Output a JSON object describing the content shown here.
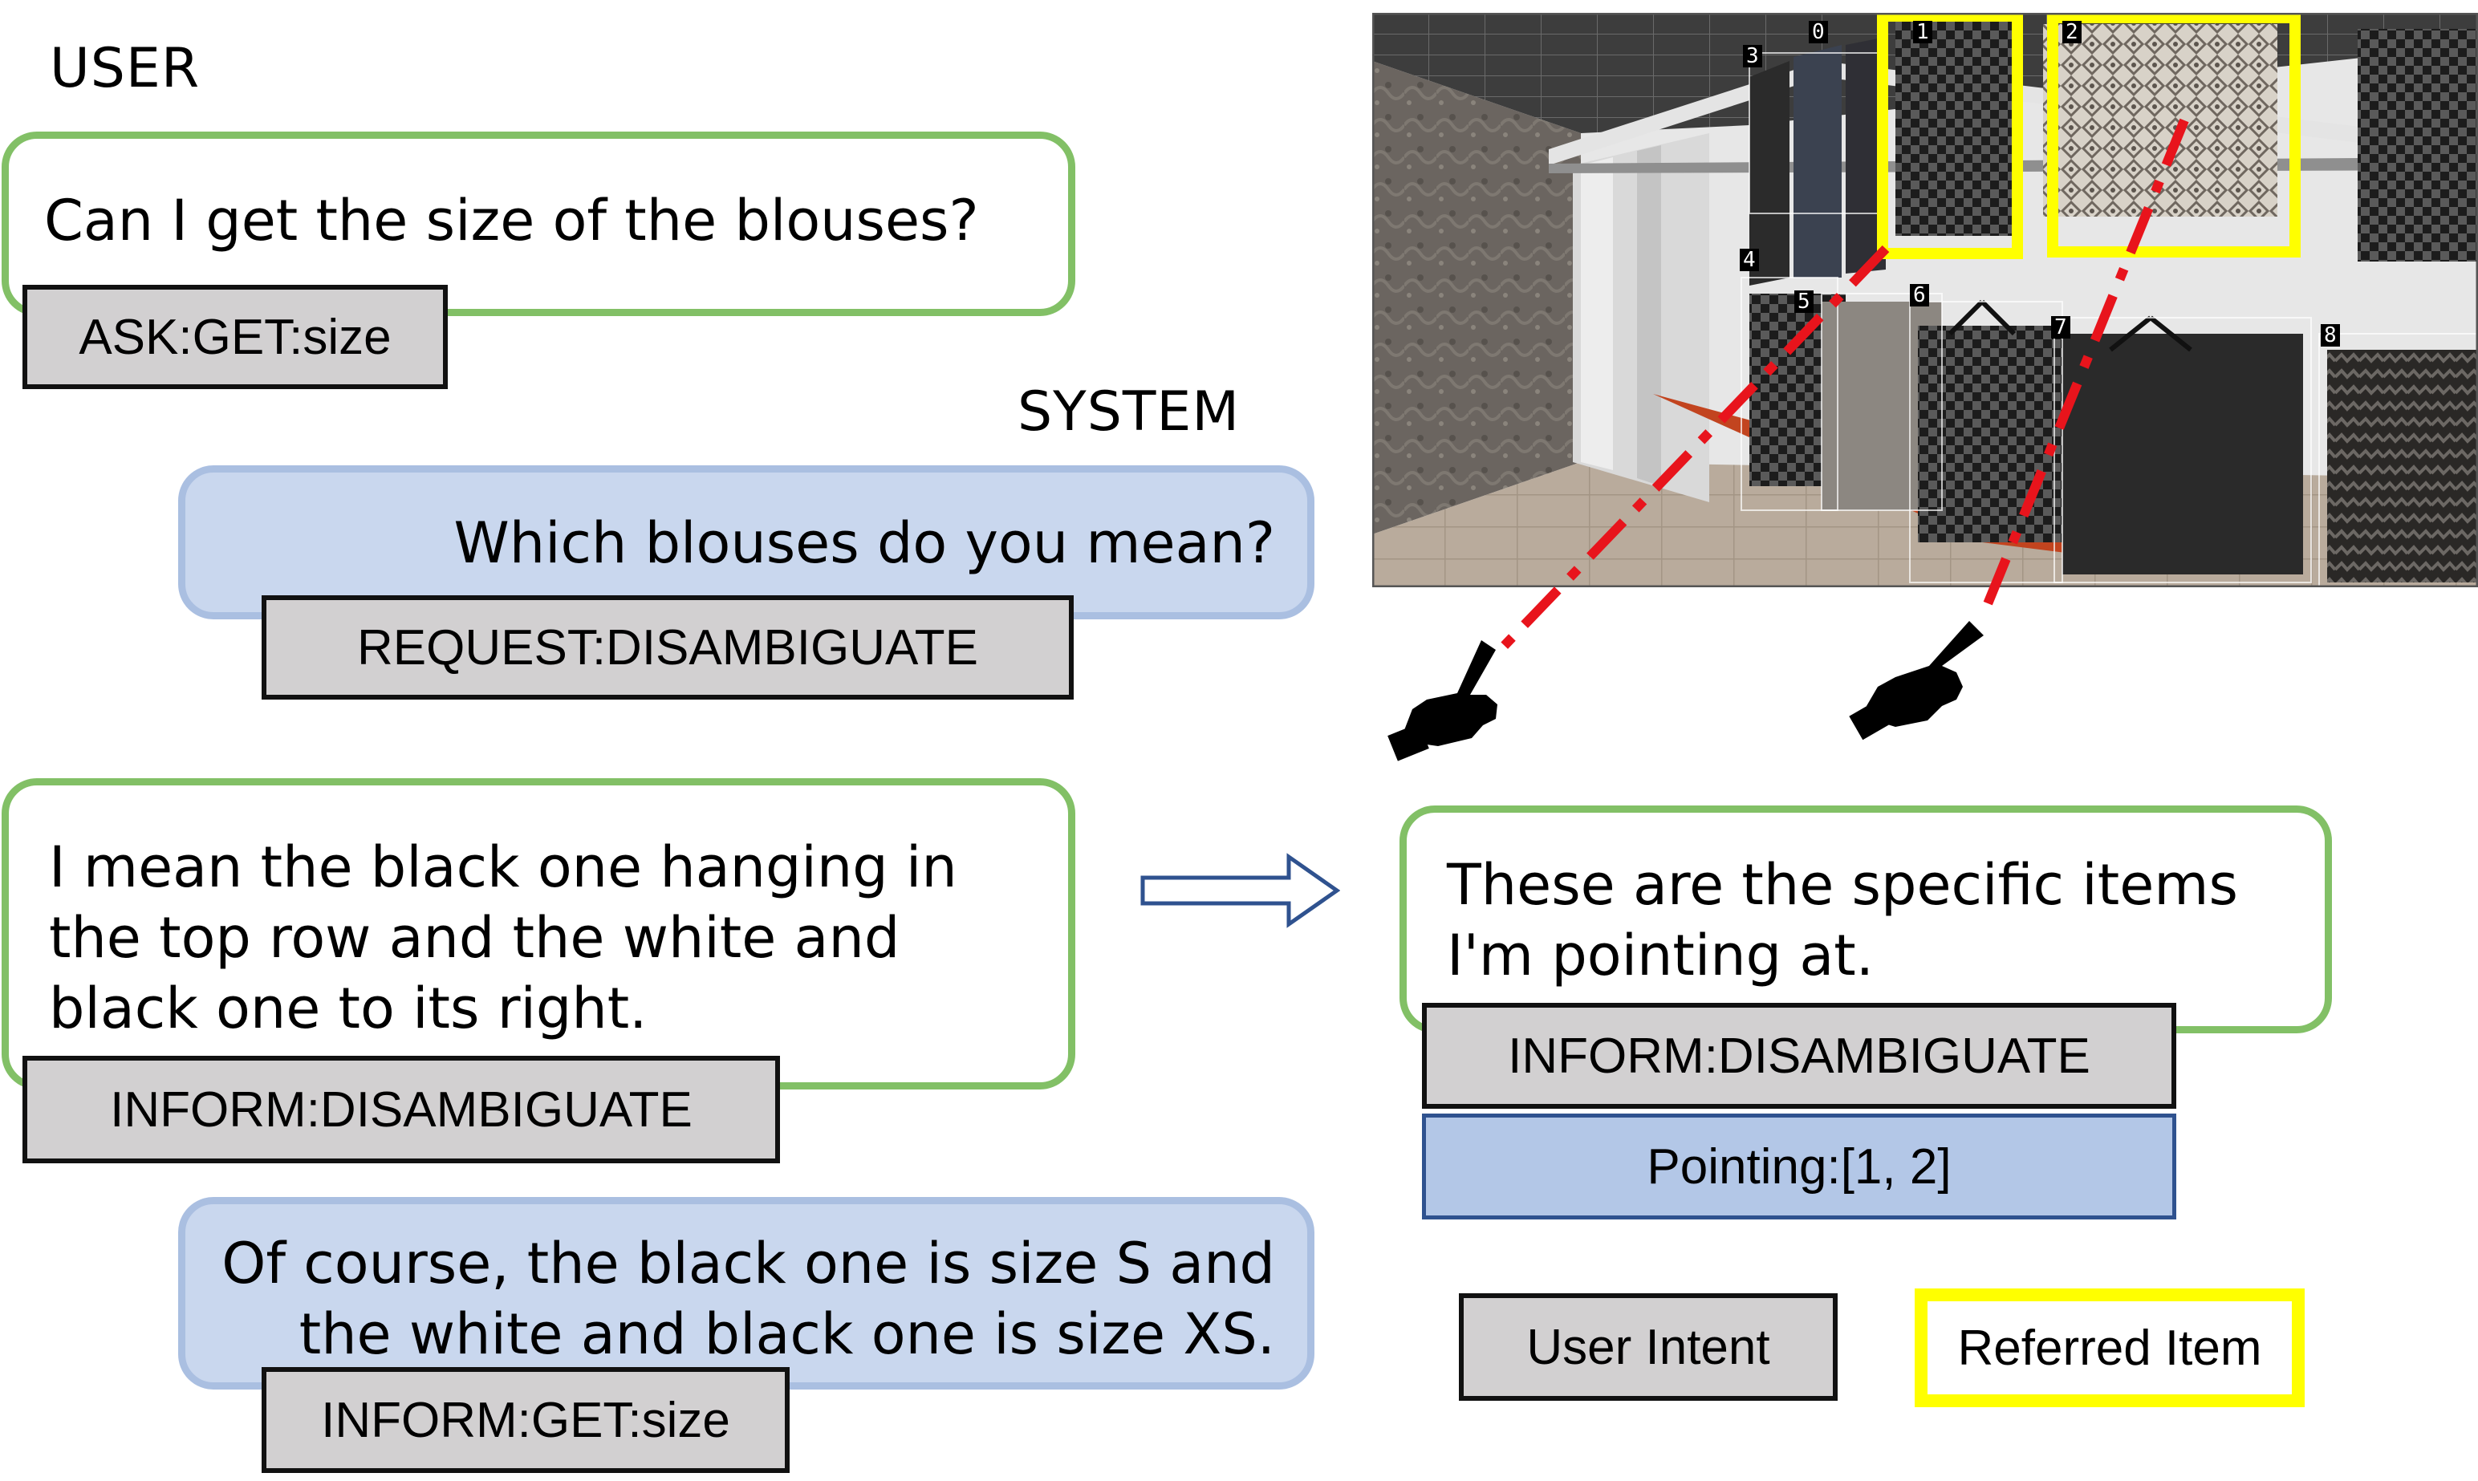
{
  "labels": {
    "user": "USER",
    "system": "SYSTEM"
  },
  "turns": [
    {
      "speaker": "user",
      "text": "Can I get the size of the blouses?",
      "intent": "ASK:GET:size"
    },
    {
      "speaker": "system",
      "text": "Which blouses do you mean?",
      "intent": "REQUEST:DISAMBIGUATE"
    },
    {
      "speaker": "user",
      "text": "I mean the black one hanging in\nthe top row and the white and\nblack one to its right.",
      "intent": "INFORM:DISAMBIGUATE"
    },
    {
      "speaker": "system",
      "text": "Of course, the black one is size S and\nthe white and black one is size XS.",
      "intent": "INFORM:GET:size"
    }
  ],
  "converted": {
    "text": "These are the specific items\nI'm pointing at.",
    "intent": "INFORM:DISAMBIGUATE",
    "pointing": "Pointing:[1, 2]"
  },
  "scene": {
    "item_ids": [
      "0",
      "1",
      "2",
      "3",
      "4",
      "5",
      "6",
      "7",
      "8"
    ],
    "referred_items": [
      "1",
      "2"
    ]
  },
  "legend": {
    "user_intent": "User Intent",
    "referred_item": "Referred Item"
  },
  "colors": {
    "user_border": "#82c066",
    "system_fill": "#c9d7ee",
    "system_border": "#aabfe1",
    "intent_fill": "#d2d0d1",
    "pointing_fill": "#b3c7e7",
    "referred_highlight": "#ffff00",
    "pointing_ray": "#e8141c",
    "arrow_outline": "#2f528f"
  }
}
